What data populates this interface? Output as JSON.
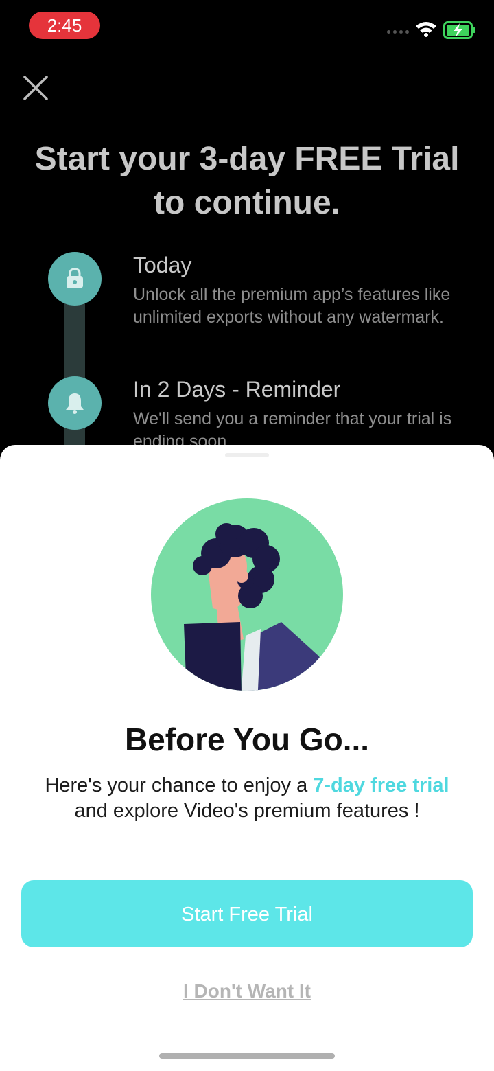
{
  "status_bar": {
    "time": "2:45",
    "icons": [
      "signal-dots-icon",
      "wifi-icon",
      "battery-charging-icon"
    ]
  },
  "background": {
    "close_icon": "close-icon",
    "headline": "Start your 3-day FREE Trial to continue.",
    "timeline": [
      {
        "icon": "lock-icon",
        "title": "Today",
        "desc": "Unlock all the premium app’s features like unlimited exports without any watermark."
      },
      {
        "icon": "bell-icon",
        "title": "In 2 Days - Reminder",
        "desc": "We'll send you a reminder that your trial is ending soon"
      }
    ]
  },
  "sheet": {
    "illustration": "person-illustration",
    "title": "Before You Go...",
    "body_before": "Here's your chance to enjoy a ",
    "body_highlight": "7-day free trial",
    "body_after": " and explore Video's premium features !",
    "cta_label": "Start Free Trial",
    "decline_label": "I Don't Want It"
  },
  "colors": {
    "accent": "#5de6e8",
    "highlight": "#4fd8df",
    "status_time_bg": "#e5343b",
    "timeline": "#5bb2ad",
    "illustration_bg": "#79dca5"
  }
}
